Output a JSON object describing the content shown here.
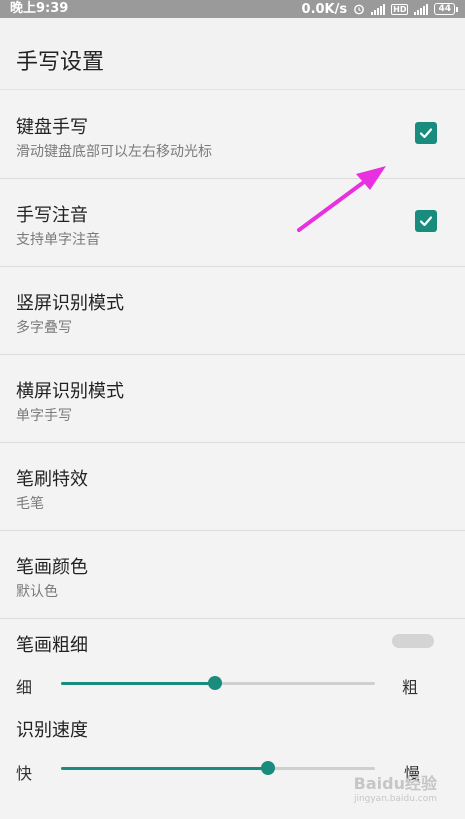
{
  "status_bar": {
    "time": "晚上9:39",
    "speed": "0.0K/s",
    "hd": "HD",
    "battery": "44"
  },
  "header": {
    "title": "手写设置"
  },
  "settings": [
    {
      "title": "键盘手写",
      "subtitle": "滑动键盘底部可以左右移动光标",
      "checked": true
    },
    {
      "title": "手写注音",
      "subtitle": "支持单字注音",
      "checked": true
    },
    {
      "title": "竖屏识别模式",
      "subtitle": "多字叠写"
    },
    {
      "title": "横屏识别模式",
      "subtitle": "单字手写"
    },
    {
      "title": "笔刷特效",
      "subtitle": "毛笔"
    },
    {
      "title": "笔画颜色",
      "subtitle": "默认色"
    }
  ],
  "stroke_width": {
    "title": "笔画粗细",
    "min_label": "细",
    "max_label": "粗",
    "value": 0.49
  },
  "recognition_speed": {
    "title": "识别速度",
    "min_label": "快",
    "max_label": "慢",
    "value": 0.66
  },
  "colors": {
    "accent": "#1a8c7e",
    "annotation_arrow": "#e830e0"
  },
  "watermark": {
    "line1": "Baidu经验",
    "line2": "jingyan.baidu.com"
  }
}
